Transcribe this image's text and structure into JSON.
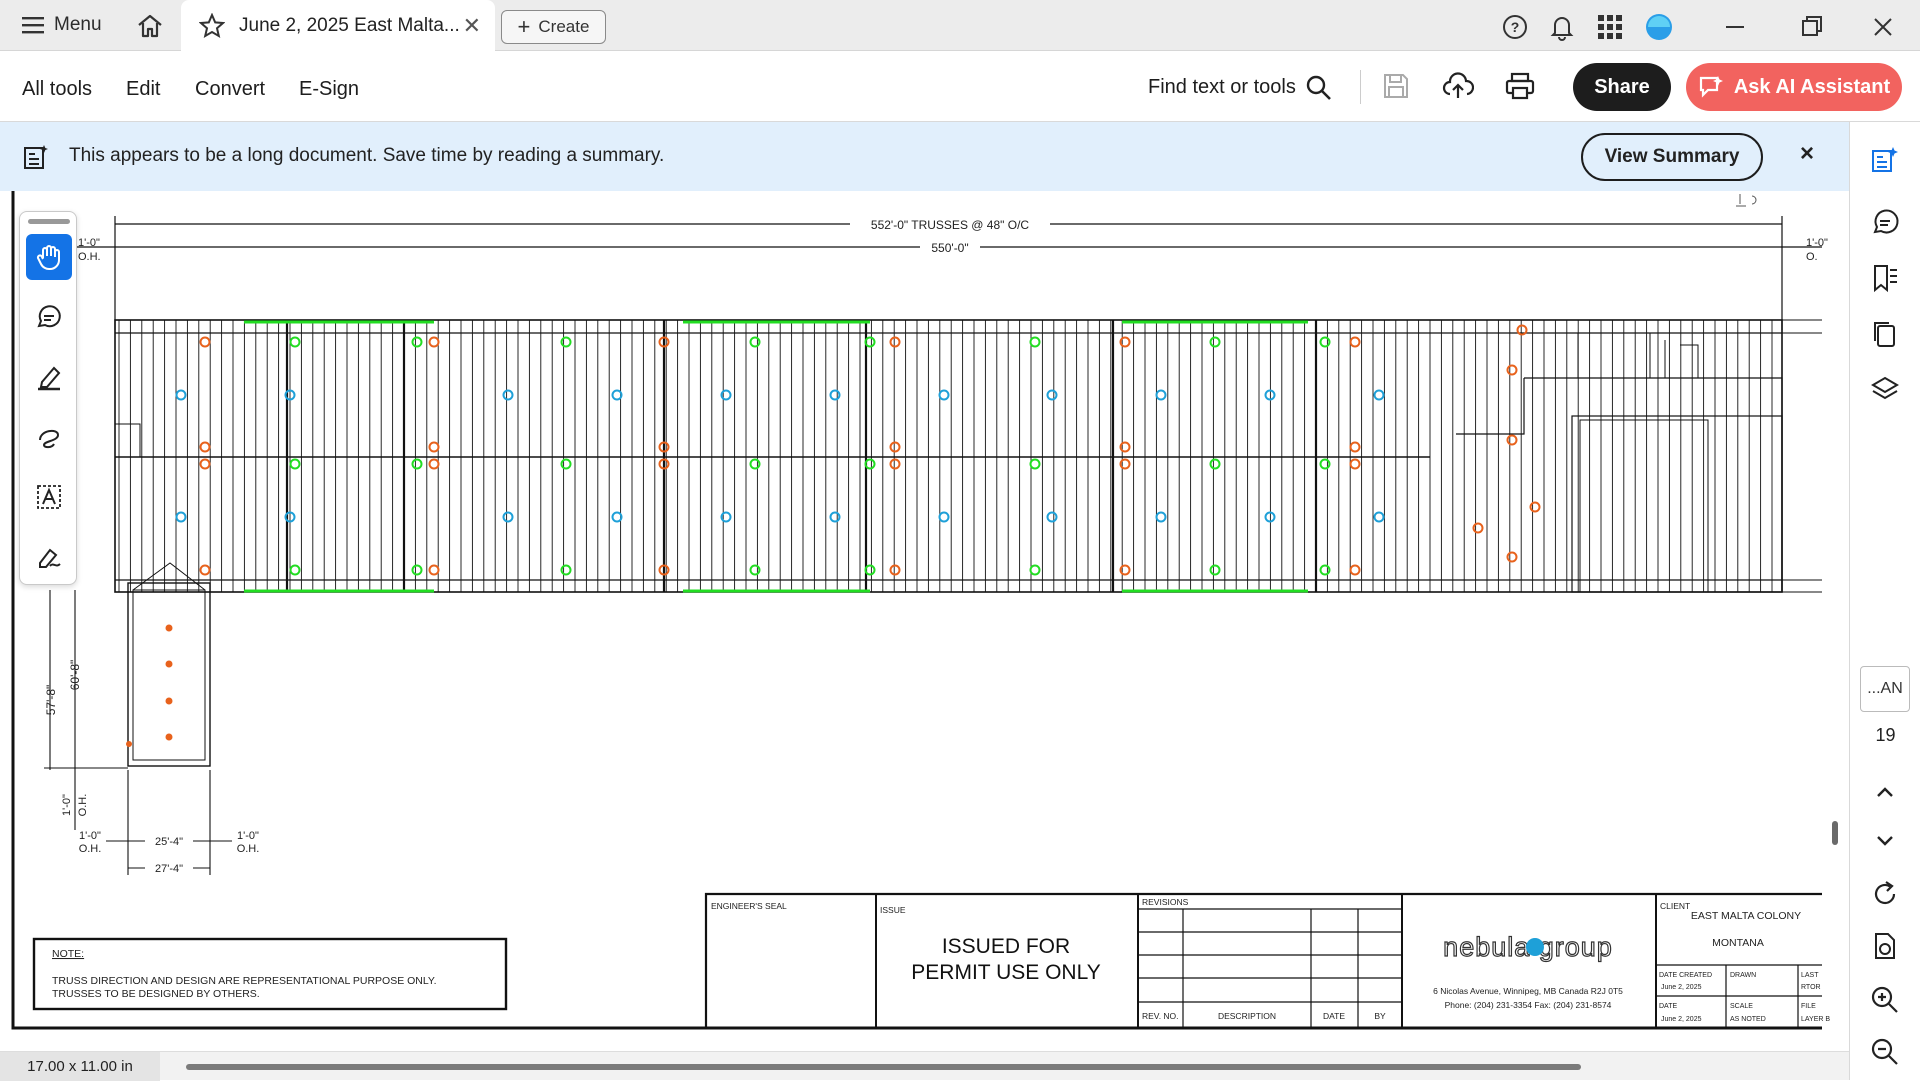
{
  "tabbar": {
    "menu_label": "Menu",
    "tab_title": "June 2, 2025 East Malta...",
    "create_label": "Create"
  },
  "toolbar": {
    "items": [
      "All tools",
      "Edit",
      "Convert",
      "E-Sign"
    ],
    "find_label": "Find text or tools",
    "share_label": "Share",
    "ai_label": "Ask AI Assistant"
  },
  "banner": {
    "message": "This appears to be a long document. Save time by reading a summary.",
    "button_label": "View Summary",
    "close_label": "×"
  },
  "rail": {
    "page_badge": "...AN",
    "page_number": "19"
  },
  "status": {
    "page_size": "17.00 x 11.00 in"
  },
  "drawing": {
    "dim_trusses": "552'-0\" TRUSSES @ 48\" O/C",
    "dim_overall": "550'-0\"",
    "dim_left_top": "1'-0\"",
    "dim_left_oh": "O.H.",
    "dim_right_top": "1'-0\"",
    "dim_right_oh": "O.",
    "dim_57_8": "57'-8\"",
    "dim_60_8": "60'-8\"",
    "dim_1_0_v": "1'-0\"",
    "dim_oh_v": "O.H.",
    "dim_1_0_l": "1'-0\"",
    "dim_oh_l": "O.H.",
    "dim_25_4": "25'-4\"",
    "dim_1_0_r": "1'-0\"",
    "dim_oh_r": "O.H.",
    "dim_27_4": "27'-4\"",
    "note_title": "NOTE:",
    "note_line1": "TRUSS DIRECTION AND DESIGN ARE REPRESENTATIONAL PURPOSE ONLY.",
    "note_line2": "TRUSSES TO BE DESIGNED BY OTHERS.",
    "engineers_seal": "ENGINEER'S SEAL",
    "issue_label": "ISSUE",
    "issue_line1": "ISSUED FOR",
    "issue_line2": "PERMIT USE ONLY",
    "revisions_label": "REVISIONS",
    "rev_no": "REV. NO.",
    "rev_desc": "DESCRIPTION",
    "rev_date": "DATE",
    "rev_by": "BY",
    "company_logo": "nebula group",
    "company_address": "6 Nicolas Avenue, Winnipeg, MB Canada R2J 0T5",
    "company_phone": "Phone: (204) 231-3354    Fax: (204) 231-8574",
    "client_label": "CLIENT",
    "client_name": "EAST MALTA COLONY",
    "client_state": "MONTANA",
    "date_created_label": "DATE CREATED",
    "date_created": "June 2, 2025",
    "drawn_label": "DRAWN",
    "last_label": "LAST",
    "last_val": "RTOR",
    "date_label": "DATE",
    "date_val": "June 2, 2025",
    "scale_label": "SCALE",
    "scale_val": "AS NOTED",
    "file_label": "FILE",
    "file_val": "LAYER B"
  },
  "colors": {
    "accent": "#1473e6",
    "ai": "#f2635f",
    "banner": "#e1effc",
    "green": "#22dd22",
    "orange": "#e8621c",
    "cyan": "#1ea0d8"
  }
}
